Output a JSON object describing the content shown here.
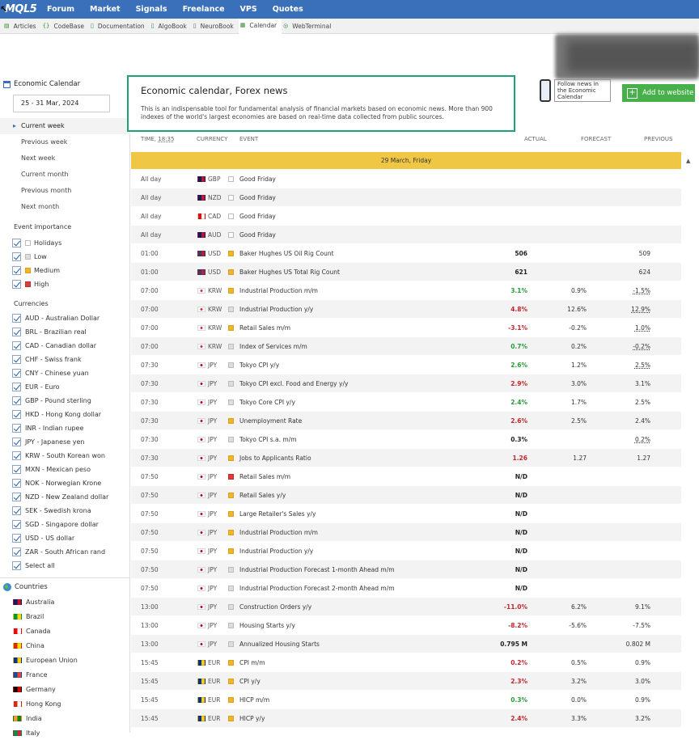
{
  "topnav": {
    "logo": "MQL5",
    "items": [
      "Forum",
      "Market",
      "Signals",
      "Freelance",
      "VPS",
      "Quotes"
    ]
  },
  "subnav": {
    "items": [
      {
        "label": "Articles",
        "icon": "articles-icon"
      },
      {
        "label": "CodeBase",
        "icon": "codebase-icon"
      },
      {
        "label": "Documentation",
        "icon": "documentation-icon"
      },
      {
        "label": "AlgoBook",
        "icon": "algobook-icon"
      },
      {
        "label": "NeuroBook",
        "icon": "neurobook-icon"
      },
      {
        "label": "Calendar",
        "icon": "calendar-icon",
        "active": true
      },
      {
        "label": "WebTerminal",
        "icon": "webterminal-icon"
      }
    ]
  },
  "sidebar": {
    "title": "Economic Calendar",
    "date_range": "25  -  31 Mar, 2024",
    "periods": [
      "Current week",
      "Previous week",
      "Next week",
      "Current month",
      "Previous month",
      "Next month"
    ],
    "active_period": "Current week",
    "importance_label": "Event importance",
    "importance": [
      {
        "label": "Holidays",
        "color": "#ffffff"
      },
      {
        "label": "Low",
        "color": "#dddddd"
      },
      {
        "label": "Medium",
        "color": "#f0b52c"
      },
      {
        "label": "High",
        "color": "#e03b3b"
      }
    ],
    "currencies_label": "Currencies",
    "currencies": [
      "AUD - Australian Dollar",
      "BRL - Brazilian real",
      "CAD - Canadian dollar",
      "CHF - Swiss frank",
      "CNY - Chinese yuan",
      "EUR - Euro",
      "GBP - Pound sterling",
      "HKD - Hong Kong dollar",
      "INR - Indian rupee",
      "JPY - Japanese yen",
      "KRW - South Korean won",
      "MXN - Mexican peso",
      "NOK - Norwegian Krone",
      "NZD - New Zealand dollar",
      "SEK - Swedish krona",
      "SGD - Singapore dollar",
      "USD - US dollar",
      "ZAR - South African rand",
      "Select all"
    ],
    "countries_label": "Countries",
    "countries": [
      {
        "name": "Australia",
        "colors": [
          "#012169",
          "#c8102e"
        ]
      },
      {
        "name": "Brazil",
        "colors": [
          "#009c3b",
          "#ffdf00"
        ]
      },
      {
        "name": "Canada",
        "colors": [
          "#ff0000",
          "#ffffff"
        ]
      },
      {
        "name": "China",
        "colors": [
          "#de2910",
          "#ffde00"
        ]
      },
      {
        "name": "European Union",
        "colors": [
          "#003399",
          "#ffcc00"
        ]
      },
      {
        "name": "France",
        "colors": [
          "#0055a4",
          "#ef4135"
        ]
      },
      {
        "name": "Germany",
        "colors": [
          "#000000",
          "#dd0000"
        ]
      },
      {
        "name": "Hong Kong",
        "colors": [
          "#de2910",
          "#ffffff"
        ]
      },
      {
        "name": "India",
        "colors": [
          "#ff9933",
          "#138808"
        ]
      },
      {
        "name": "Italy",
        "colors": [
          "#009246",
          "#ce2b37"
        ]
      }
    ]
  },
  "main": {
    "title": "Economic calendar, Forex news",
    "description": "This is an indispensable tool for fundamental analysis of financial markets based on economic news. More than 900 indexes of the world's largest economies are based on real-time data collected from public sources.",
    "follow_text": "Follow news in the Economic Calendar",
    "add_button": "Add to website",
    "columns": {
      "time": "TIME,",
      "time_value": "18:35",
      "currency": "CURRENCY",
      "event": "EVENT",
      "actual": "ACTUAL",
      "forecast": "FORECAST",
      "previous": "PREVIOUS"
    },
    "day": "29 March, Friday",
    "rows": [
      {
        "time": "All day",
        "cur": "GBP",
        "imp": "holiday",
        "event": "Good Friday",
        "actual": "",
        "forecast": "",
        "previous": ""
      },
      {
        "time": "All day",
        "cur": "NZD",
        "imp": "holiday",
        "event": "Good Friday",
        "actual": "",
        "forecast": "",
        "previous": ""
      },
      {
        "time": "All day",
        "cur": "CAD",
        "imp": "holiday",
        "event": "Good Friday",
        "actual": "",
        "forecast": "",
        "previous": ""
      },
      {
        "time": "All day",
        "cur": "AUD",
        "imp": "holiday",
        "event": "Good Friday",
        "actual": "",
        "forecast": "",
        "previous": ""
      },
      {
        "time": "01:00",
        "cur": "USD",
        "imp": "medium",
        "event": "Baker Hughes US Oil Rig Count",
        "actual": "506",
        "aclass": "neu",
        "forecast": "",
        "previous": "509"
      },
      {
        "time": "01:00",
        "cur": "USD",
        "imp": "medium",
        "event": "Baker Hughes US Total Rig Count",
        "actual": "621",
        "aclass": "neu",
        "forecast": "",
        "previous": "624"
      },
      {
        "time": "07:00",
        "cur": "KRW",
        "imp": "medium",
        "event": "Industrial Production m/m",
        "actual": "3.1%",
        "aclass": "pos",
        "forecast": "0.9%",
        "previous": "-1.5%",
        "pdot": true
      },
      {
        "time": "07:00",
        "cur": "KRW",
        "imp": "low",
        "event": "Industrial Production y/y",
        "actual": "4.8%",
        "aclass": "neg",
        "forecast": "12.6%",
        "previous": "12.9%",
        "pdot": true
      },
      {
        "time": "07:00",
        "cur": "KRW",
        "imp": "medium",
        "event": "Retail Sales m/m",
        "actual": "-3.1%",
        "aclass": "neg",
        "forecast": "-0.2%",
        "previous": "1.0%",
        "pdot": true
      },
      {
        "time": "07:00",
        "cur": "KRW",
        "imp": "low",
        "event": "Index of Services m/m",
        "actual": "0.7%",
        "aclass": "pos",
        "forecast": "0.2%",
        "previous": "-0.2%",
        "pdot": true
      },
      {
        "time": "07:30",
        "cur": "JPY",
        "imp": "low",
        "event": "Tokyo CPI y/y",
        "actual": "2.6%",
        "aclass": "pos",
        "forecast": "1.2%",
        "previous": "2.5%",
        "pdot": true
      },
      {
        "time": "07:30",
        "cur": "JPY",
        "imp": "low",
        "event": "Tokyo CPI excl. Food and Energy y/y",
        "actual": "2.9%",
        "aclass": "neg",
        "forecast": "3.0%",
        "previous": "3.1%"
      },
      {
        "time": "07:30",
        "cur": "JPY",
        "imp": "low",
        "event": "Tokyo Core CPI y/y",
        "actual": "2.4%",
        "aclass": "pos",
        "forecast": "1.7%",
        "previous": "2.5%"
      },
      {
        "time": "07:30",
        "cur": "JPY",
        "imp": "medium",
        "event": "Unemployment Rate",
        "actual": "2.6%",
        "aclass": "neg",
        "forecast": "2.5%",
        "previous": "2.4%"
      },
      {
        "time": "07:30",
        "cur": "JPY",
        "imp": "low",
        "event": "Tokyo CPI s.a. m/m",
        "actual": "0.3%",
        "aclass": "neu",
        "forecast": "",
        "previous": "0.2%",
        "pdot": true
      },
      {
        "time": "07:30",
        "cur": "JPY",
        "imp": "medium",
        "event": "Jobs to Applicants Ratio",
        "actual": "1.26",
        "aclass": "neg",
        "forecast": "1.27",
        "previous": "1.27"
      },
      {
        "time": "07:50",
        "cur": "JPY",
        "imp": "high",
        "event": "Retail Sales m/m",
        "actual": "N/D",
        "aclass": "neu",
        "forecast": "",
        "previous": ""
      },
      {
        "time": "07:50",
        "cur": "JPY",
        "imp": "medium",
        "event": "Retail Sales y/y",
        "actual": "N/D",
        "aclass": "neu",
        "forecast": "",
        "previous": ""
      },
      {
        "time": "07:50",
        "cur": "JPY",
        "imp": "medium",
        "event": "Large Retailer's Sales y/y",
        "actual": "N/D",
        "aclass": "neu",
        "forecast": "",
        "previous": ""
      },
      {
        "time": "07:50",
        "cur": "JPY",
        "imp": "medium",
        "event": "Industrial Production m/m",
        "actual": "N/D",
        "aclass": "neu",
        "forecast": "",
        "previous": ""
      },
      {
        "time": "07:50",
        "cur": "JPY",
        "imp": "medium",
        "event": "Industrial Production y/y",
        "actual": "N/D",
        "aclass": "neu",
        "forecast": "",
        "previous": ""
      },
      {
        "time": "07:50",
        "cur": "JPY",
        "imp": "low",
        "event": "Industrial Production Forecast 1-month Ahead m/m",
        "actual": "N/D",
        "aclass": "neu",
        "forecast": "",
        "previous": ""
      },
      {
        "time": "07:50",
        "cur": "JPY",
        "imp": "low",
        "event": "Industrial Production Forecast 2-month Ahead m/m",
        "actual": "N/D",
        "aclass": "neu",
        "forecast": "",
        "previous": ""
      },
      {
        "time": "13:00",
        "cur": "JPY",
        "imp": "low",
        "event": "Construction Orders y/y",
        "actual": "-11.0%",
        "aclass": "neg",
        "forecast": "6.2%",
        "previous": "9.1%"
      },
      {
        "time": "13:00",
        "cur": "JPY",
        "imp": "low",
        "event": "Housing Starts y/y",
        "actual": "-8.2%",
        "aclass": "neg",
        "forecast": "-5.6%",
        "previous": "-7.5%"
      },
      {
        "time": "13:00",
        "cur": "JPY",
        "imp": "low",
        "event": "Annualized Housing Starts",
        "actual": "0.795 M",
        "aclass": "neu",
        "forecast": "",
        "previous": "0.802 M"
      },
      {
        "time": "15:45",
        "cur": "EUR",
        "imp": "medium",
        "event": "CPI m/m",
        "actual": "0.2%",
        "aclass": "neg",
        "forecast": "0.5%",
        "previous": "0.9%"
      },
      {
        "time": "15:45",
        "cur": "EUR",
        "imp": "medium",
        "event": "CPI y/y",
        "actual": "2.3%",
        "aclass": "neg",
        "forecast": "3.2%",
        "previous": "3.0%"
      },
      {
        "time": "15:45",
        "cur": "EUR",
        "imp": "medium",
        "event": "HICP m/m",
        "actual": "0.3%",
        "aclass": "pos",
        "forecast": "0.0%",
        "previous": "0.9%"
      },
      {
        "time": "15:45",
        "cur": "EUR",
        "imp": "medium",
        "event": "HICP y/y",
        "actual": "2.4%",
        "aclass": "neg",
        "forecast": "3.3%",
        "previous": "3.2%"
      }
    ]
  }
}
